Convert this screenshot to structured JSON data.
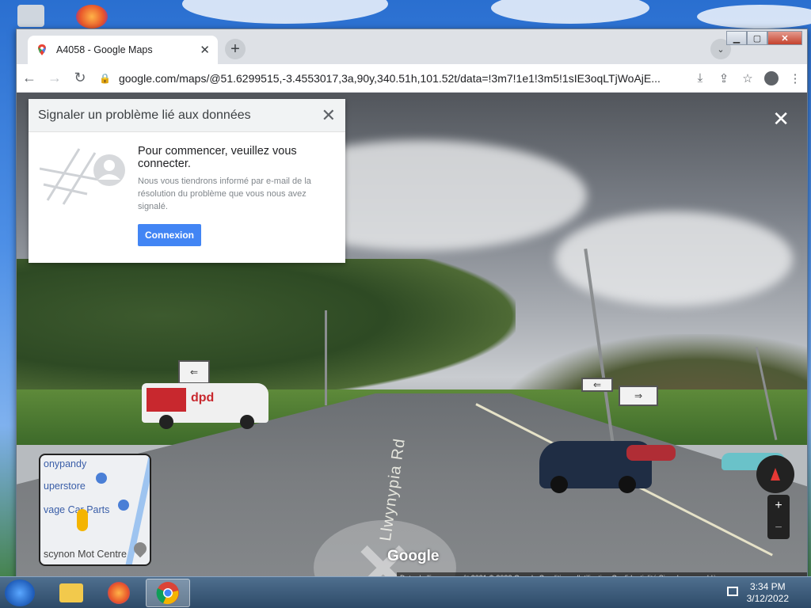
{
  "browser": {
    "tab_title": "A4058 - Google Maps",
    "new_tab_label": "+",
    "url": "google.com/maps/@51.6299515,-3.4553017,3a,90y,340.51h,101.52t/data=!3m7!1e1!3m5!1sIE3oqLTjWoAjE..."
  },
  "report_panel": {
    "title": "Signaler un problème lié aux données",
    "heading": "Pour commencer, veuillez vous connecter.",
    "description": "Nous vous tiendrons informé par e-mail de la résolution du problème que vous nous avez signalé.",
    "button_label": "Connexion"
  },
  "street_view": {
    "road_label": "Llwynypia Rd",
    "van_logo": "dpd",
    "logo": "Google",
    "attribution": "Date de l'image : août 2021   © 2022 Google   Conditions d'utilisation   Confidentialité   Signaler un problème"
  },
  "minimap": {
    "labels": [
      "onypandy",
      "uperstore",
      "vage Car Parts",
      "scynon Mot Centre"
    ]
  },
  "zoom": {
    "in": "+",
    "out": "−"
  },
  "taskbar": {
    "time": "3:34 PM",
    "date": "3/12/2022"
  },
  "colors": {
    "accent": "#4285f4",
    "panel_header": "#f1f3f4"
  }
}
